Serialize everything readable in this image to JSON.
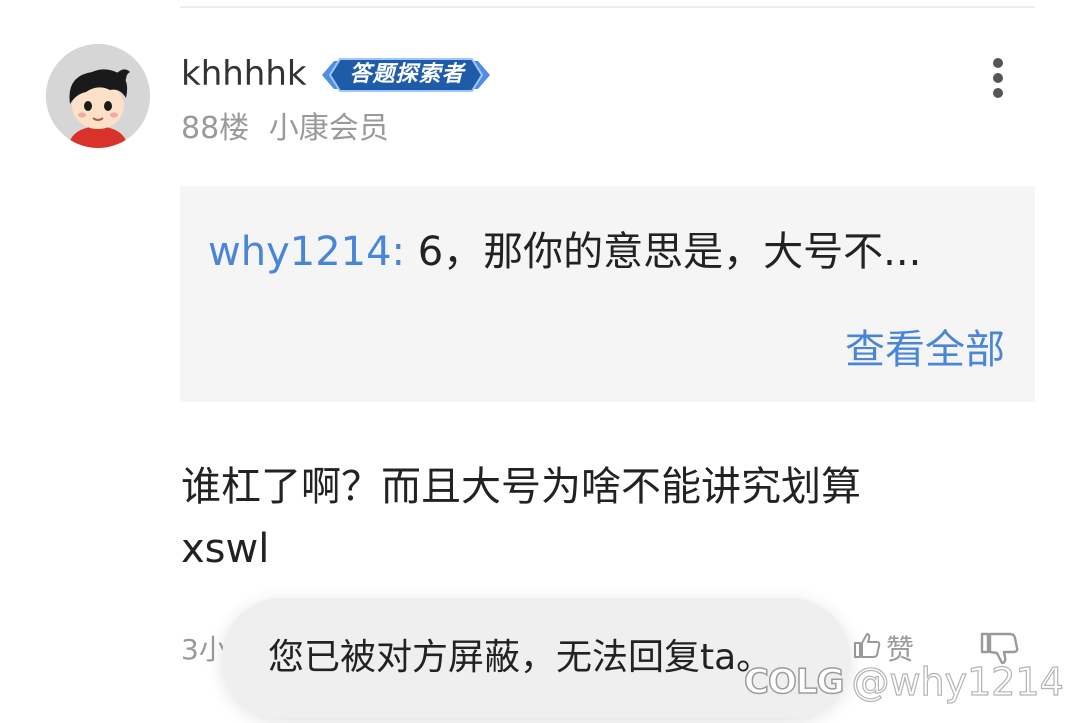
{
  "comment": {
    "username": "khhhhk",
    "badge": "答题探索者",
    "floor": "88楼",
    "membership": "小康会员",
    "quote": {
      "author": "why1214:",
      "text": "6，那你的意思是，大号不...",
      "view_all": "查看全部"
    },
    "body_lines": [
      "谁杠了啊？而且大号为啥不能讲究划算",
      "xswl"
    ],
    "time": "3小",
    "like_label": "赞"
  },
  "toast": {
    "message": "您已被对方屏蔽，无法回复ta。"
  },
  "watermark": {
    "logo": "COLG",
    "handle": "@why1214"
  },
  "colors": {
    "link": "#4a86d8",
    "badge_bg": "#1e5ba8",
    "meta_text": "#9a9a9a",
    "quote_bg": "#f5f5f5",
    "toast_bg": "#efefef"
  },
  "icons": {
    "more": "more-vertical-icon",
    "like": "thumb-up-icon",
    "dislike": "thumb-down-icon",
    "avatar": "cartoon-boy-avatar"
  }
}
